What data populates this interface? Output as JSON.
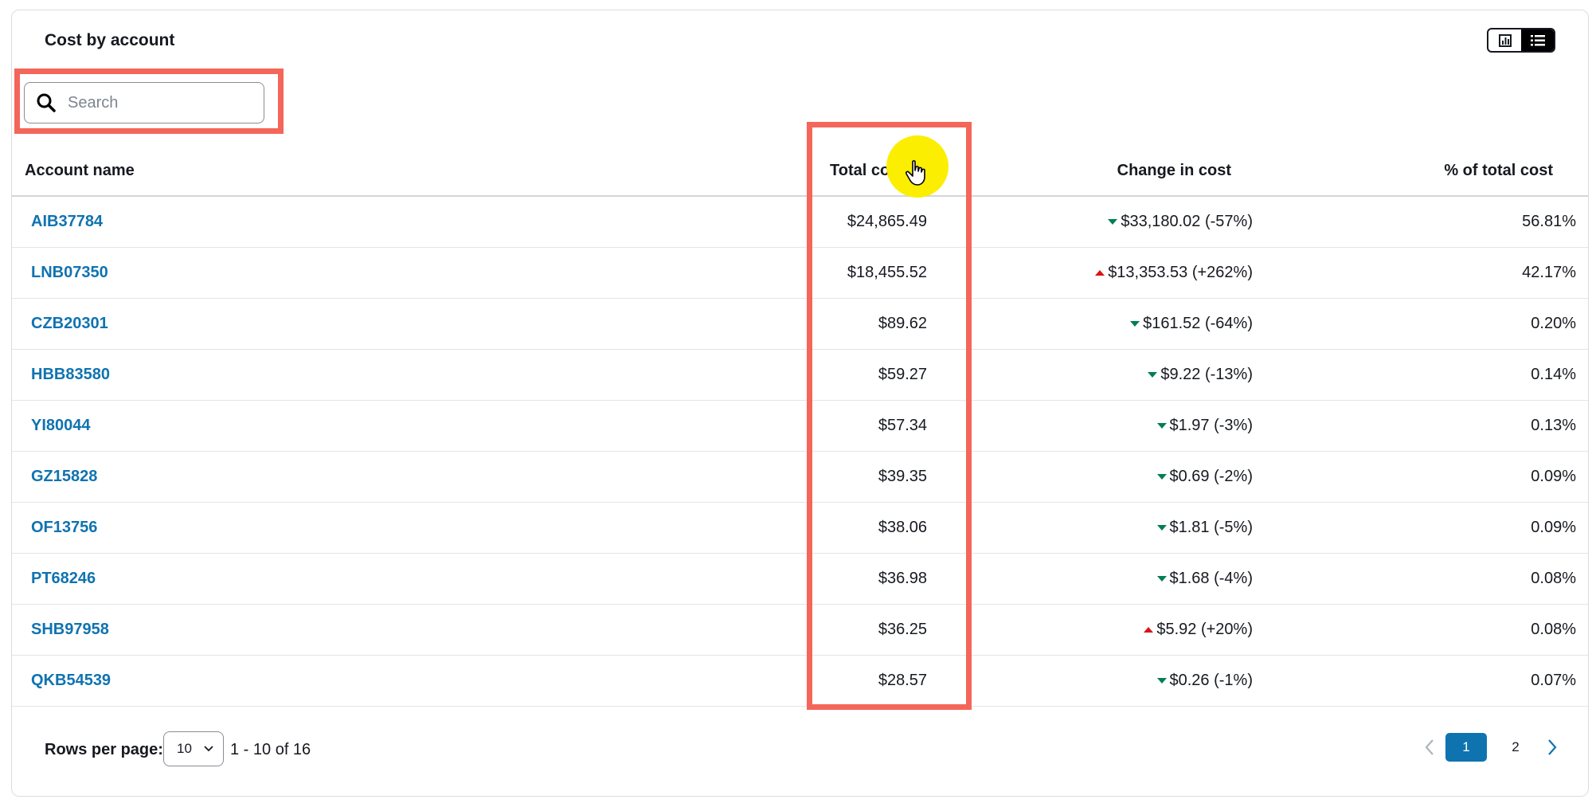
{
  "card": {
    "title": "Cost by account",
    "view_toggle": {
      "chart_icon": "bar-chart-icon",
      "list_icon": "list-icon",
      "active": "list"
    }
  },
  "search": {
    "placeholder": "Search",
    "value": ""
  },
  "table": {
    "headers": {
      "account": "Account name",
      "total": "Total cost",
      "total_sort": "↓",
      "change": "Change in cost",
      "pct": "% of total cost"
    },
    "rows": [
      {
        "account": "AIB37784",
        "total": "$24,865.49",
        "change": "$33,180.02 (-57%)",
        "direction": "down",
        "pct": "56.81%"
      },
      {
        "account": "LNB07350",
        "total": "$18,455.52",
        "change": "$13,353.53 (+262%)",
        "direction": "up",
        "pct": "42.17%"
      },
      {
        "account": "CZB20301",
        "total": "$89.62",
        "change": "$161.52 (-64%)",
        "direction": "down",
        "pct": "0.20%"
      },
      {
        "account": "HBB83580",
        "total": "$59.27",
        "change": "$9.22 (-13%)",
        "direction": "down",
        "pct": "0.14%"
      },
      {
        "account": "YI80044",
        "total": "$57.34",
        "change": "$1.97 (-3%)",
        "direction": "down",
        "pct": "0.13%"
      },
      {
        "account": "GZ15828",
        "total": "$39.35",
        "change": "$0.69 (-2%)",
        "direction": "down",
        "pct": "0.09%"
      },
      {
        "account": "OF13756",
        "total": "$38.06",
        "change": "$1.81 (-5%)",
        "direction": "down",
        "pct": "0.09%"
      },
      {
        "account": "PT68246",
        "total": "$36.98",
        "change": "$1.68 (-4%)",
        "direction": "down",
        "pct": "0.08%"
      },
      {
        "account": "SHB97958",
        "total": "$36.25",
        "change": "$5.92 (+20%)",
        "direction": "up",
        "pct": "0.08%"
      },
      {
        "account": "QKB54539",
        "total": "$28.57",
        "change": "$0.26 (-1%)",
        "direction": "down",
        "pct": "0.07%"
      }
    ]
  },
  "footer": {
    "rows_per_page_label": "Rows per page:",
    "rows_per_page_value": "10",
    "range": "1 - 10 of 16",
    "pages": [
      "1",
      "2"
    ],
    "current_page": "1"
  },
  "colors": {
    "link": "#0f73b0",
    "decrease": "#037f51",
    "increase": "#d91515",
    "highlight_box": "#f4665a",
    "cursor_highlight": "#fbee00"
  }
}
